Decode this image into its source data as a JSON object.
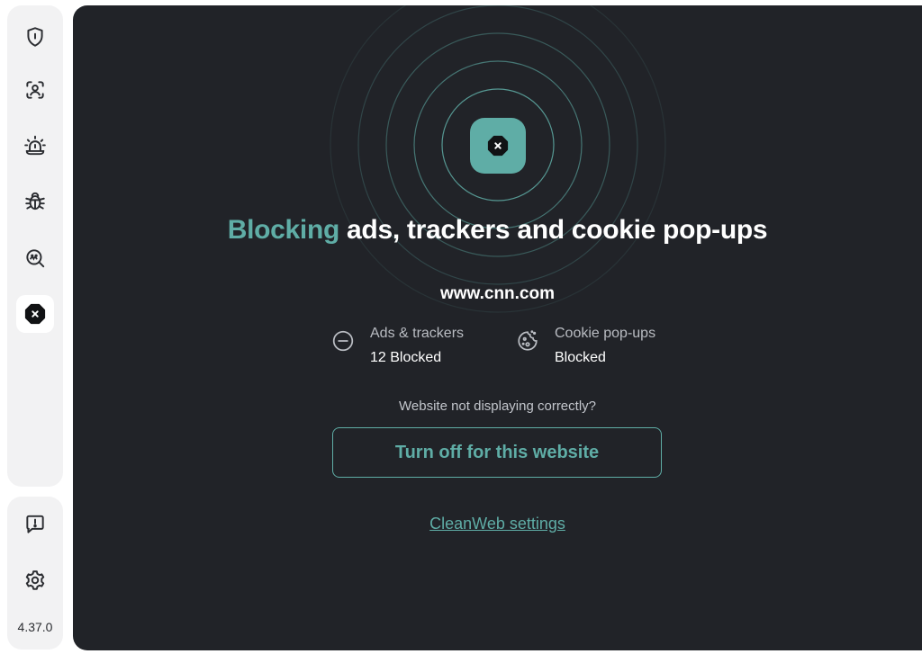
{
  "sidebar": {
    "items": [
      {
        "icon": "shield-icon",
        "active": false
      },
      {
        "icon": "face-scan-icon",
        "active": false
      },
      {
        "icon": "alarm-light-icon",
        "active": false
      },
      {
        "icon": "bug-icon",
        "active": false
      },
      {
        "icon": "magnifier-icon",
        "active": false
      },
      {
        "icon": "block-octagon-icon",
        "active": true
      }
    ],
    "bottom_items": [
      {
        "icon": "feedback-icon"
      },
      {
        "icon": "gear-icon"
      }
    ],
    "version": "4.37.0"
  },
  "main": {
    "headline_accent": "Blocking",
    "headline_rest": " ads, trackers and cookie pop-ups",
    "domain": "www.cnn.com",
    "stats": [
      {
        "icon": "minus-circle-icon",
        "label": "Ads & trackers",
        "value": "12 Blocked"
      },
      {
        "icon": "cookie-icon",
        "label": "Cookie pop-ups",
        "value": "Blocked"
      }
    ],
    "question": "Website not displaying correctly?",
    "turn_off_label": "Turn off for this website",
    "settings_link": "CleanWeb settings"
  },
  "colors": {
    "accent": "#5fada6",
    "panel_bg": "#212328",
    "sidebar_bg": "#f2f2f3"
  }
}
